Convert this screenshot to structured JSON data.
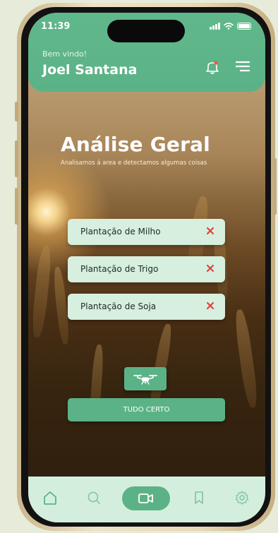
{
  "status_bar": {
    "time": "11:39"
  },
  "header": {
    "greeting": "Bem vindo!",
    "user_name": "Joel Santana"
  },
  "main": {
    "title": "Análise Geral",
    "subtitle": "Analisamos á area e detectamos algumas coisas",
    "crops": [
      {
        "label": "Plantação de Milho"
      },
      {
        "label": "Plantação de Trigo"
      },
      {
        "label": "Plantação de Soja"
      }
    ],
    "ok_button": "TUDO CERTO"
  },
  "icons": {
    "notification": "bell-icon",
    "menu": "hamburger-menu-icon",
    "remove": "close-icon",
    "drone": "drone-icon",
    "nav": [
      "home-icon",
      "search-icon",
      "video-camera-icon",
      "bookmark-icon",
      "settings-icon"
    ]
  },
  "colors": {
    "primary": "#5bb287",
    "card": "#d6efdf",
    "danger": "#e53935",
    "notification_dot": "#ef5a3c"
  }
}
